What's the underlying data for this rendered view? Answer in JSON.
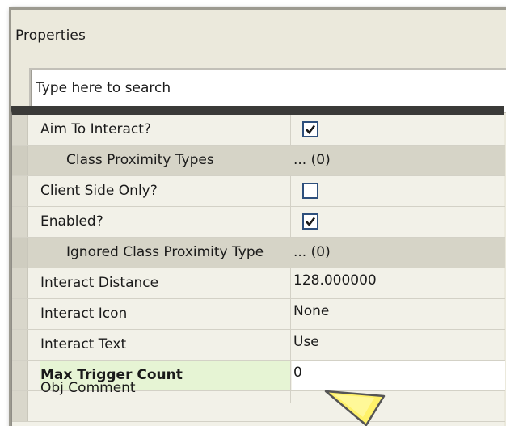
{
  "panel": {
    "title": "Properties"
  },
  "search": {
    "placeholder": "Type here to search"
  },
  "properties": [
    {
      "label": "Aim To Interact?",
      "type": "checkbox",
      "checked": true
    },
    {
      "label": "Class Proximity Types",
      "value": "... (0)",
      "sub": true
    },
    {
      "label": "Client Side Only?",
      "type": "checkbox",
      "checked": false
    },
    {
      "label": "Enabled?",
      "type": "checkbox",
      "checked": true
    },
    {
      "label": "Ignored Class Proximity Type",
      "value": "... (0)",
      "sub": true
    },
    {
      "label": "Interact Distance",
      "value": "128.000000"
    },
    {
      "label": "Interact Icon",
      "value": "None"
    },
    {
      "label": "Interact Text",
      "value": "Use"
    },
    {
      "label": "Max Trigger Count",
      "value": "0",
      "selected": true
    },
    {
      "label": "Obj Comment",
      "value": ""
    }
  ],
  "colors": {
    "accent_selected": "#e6f4d4",
    "cursor_fill": "#fff26a",
    "header_bar": "#3a3a38"
  },
  "icons": {
    "checkmark": "checkmark-icon",
    "cursor": "pointer-arrow-icon"
  }
}
